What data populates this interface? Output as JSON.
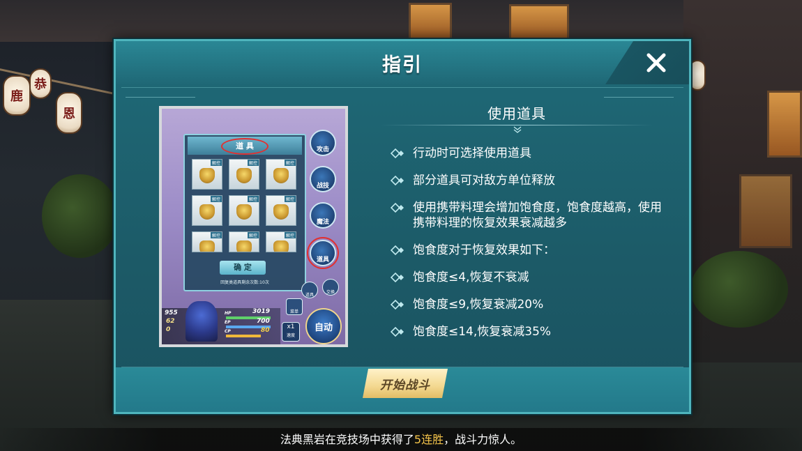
{
  "dialog": {
    "title": "指引",
    "subtitle": "使用道具",
    "bullets": [
      "行动时可选择使用道具",
      "部分道具可对敌方单位释放",
      "使用携带料理会增加饱食度，饱食度越高，使用携带料理的恢复效果衰减越多",
      "饱食度对于恢复效果如下：",
      "饱食度≤4,恢复不衰减",
      "饱食度≤9,恢复衰减20%",
      "饱食度≤14,恢复衰减35%"
    ],
    "start_button": "开始战斗",
    "close_icon": "close-icon"
  },
  "tutorial_image": {
    "panel_title": "道 具",
    "slot_tag": "解控",
    "confirm_label": "确 定",
    "remain_text": "回复类道具剩余次数:10次",
    "side_buttons": [
      "攻击",
      "战技",
      "魔法",
      "道具"
    ],
    "small_buttons": [
      "道具",
      "交换",
      "菜单"
    ],
    "auto_label": "自动",
    "speed_label": "x1",
    "speed_sub": "速度",
    "hp_label": "HP",
    "ep_label": "EP",
    "cp_label": "CP",
    "hp_value": "3019",
    "ep_value": "700",
    "cp_value": "80",
    "left_nums": [
      "955",
      "62",
      "0"
    ]
  },
  "ticker": {
    "part1": "法典黑岩在竞技场中获得了",
    "highlight": "5连胜",
    "part2": "，战斗力惊人。"
  },
  "background": {
    "lantern_chars": [
      "鹿",
      "恭",
      "恩"
    ]
  },
  "colors": {
    "dialog_bg": "#1f6a78",
    "dialog_border": "#4fb5bd",
    "start_button": "#f3d890",
    "highlight_gold": "#f5c44a",
    "annotation_red": "#e23030"
  }
}
